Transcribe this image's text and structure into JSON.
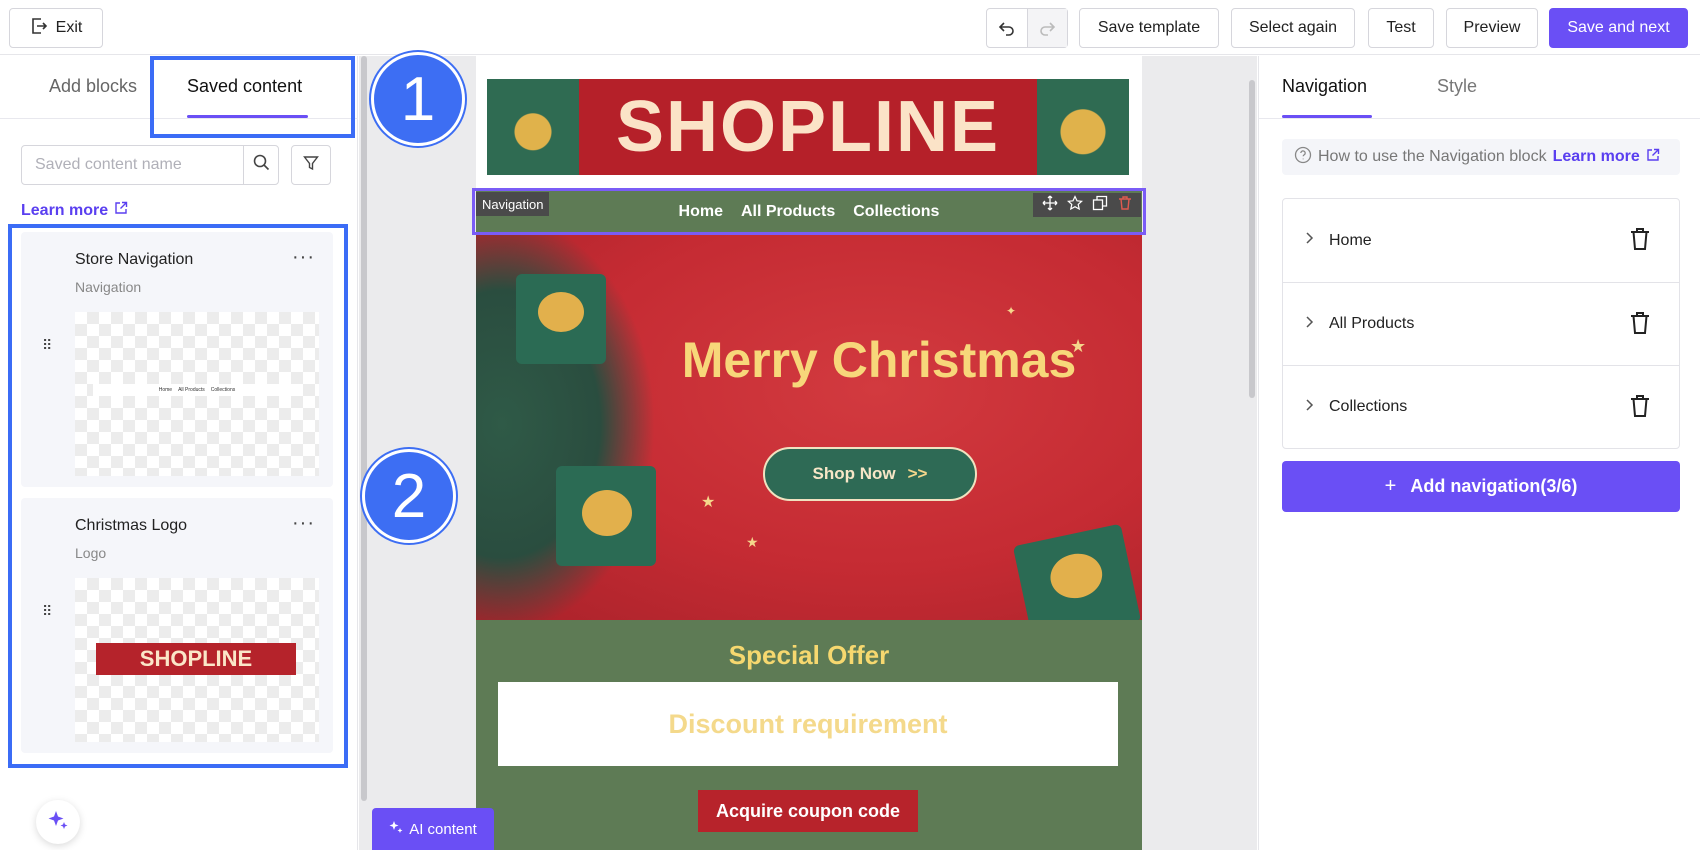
{
  "topbar": {
    "exit_label": "Exit",
    "undo_icon": "undo-icon",
    "redo_icon": "redo-icon",
    "buttons": {
      "save_template": "Save template",
      "select_again": "Select again",
      "test": "Test",
      "preview": "Preview",
      "save_and_next": "Save and next"
    }
  },
  "left_panel": {
    "tabs": [
      "Add blocks",
      "Saved content"
    ],
    "active_tab": "Saved content",
    "search_placeholder": "Saved content name",
    "learn_more": "Learn more",
    "saved_items": [
      {
        "title": "Store Navigation",
        "type": "Navigation",
        "preview_links": [
          "Home",
          "All Products",
          "Collections"
        ]
      },
      {
        "title": "Christmas Logo",
        "type": "Logo",
        "preview_text": "SHOPLINE"
      }
    ]
  },
  "canvas": {
    "banner_text": "SHOPLINE",
    "nav_block_label": "Navigation",
    "nav_links": [
      "Home",
      "All Products",
      "Collections"
    ],
    "hero_title": "Merry Christmas",
    "shop_button": "Shop Now",
    "shop_button_arrows": ">>",
    "offer_title": "Special Offer",
    "offer_box_text": "Discount requirement",
    "coupon_button": "Acquire coupon code",
    "ai_button": "AI content"
  },
  "annotations": {
    "badge_1": "1",
    "badge_2": "2"
  },
  "right_panel": {
    "tabs": [
      "Navigation",
      "Style"
    ],
    "active_tab": "Navigation",
    "help_text": "How to use the Navigation block",
    "help_link": "Learn more",
    "nav_items": [
      "Home",
      "All Products",
      "Collections"
    ],
    "add_button": "Add navigation(3/6)",
    "add_button_icon": "+"
  },
  "colors": {
    "accent": "#6a4ff5",
    "highlight_blue": "#3b6cf6",
    "banner_red": "#b52029",
    "email_green": "#5e7b55",
    "gold_text": "#f7d77a"
  }
}
